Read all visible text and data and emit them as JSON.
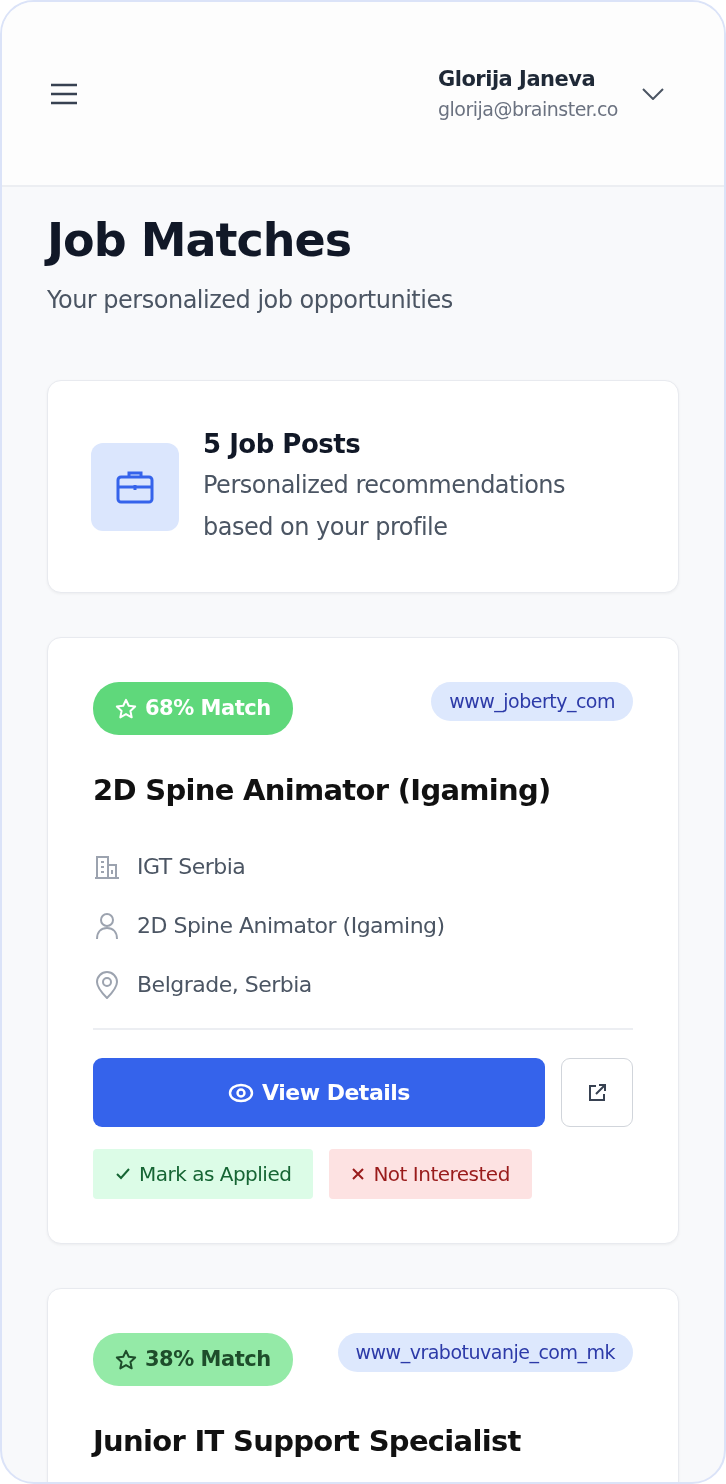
{
  "header": {
    "user_name": "Glorija Janeva",
    "user_email": "glorija@brainster.co"
  },
  "page": {
    "title": "Job Matches",
    "subtitle": "Your personalized job opportunities"
  },
  "summary": {
    "title": "5 Job Posts",
    "description": "Personalized recommendations based on your profile"
  },
  "jobs": [
    {
      "match": "68% Match",
      "color": "#5fd87b",
      "source": "www_joberty_com",
      "title": "2D Spine Animator (Igaming)",
      "company": "IGT Serbia",
      "position": "2D Spine Animator (Igaming)",
      "location": "Belgrade, Serbia",
      "view_label": "View Details",
      "applied_label": "Mark as Applied",
      "dismiss_label": "Not Interested"
    },
    {
      "match": "38% Match",
      "color": "#94eaa7",
      "source": "www_vrabotuvanje_com_mk",
      "title": "Junior IT Support Specialist"
    }
  ]
}
